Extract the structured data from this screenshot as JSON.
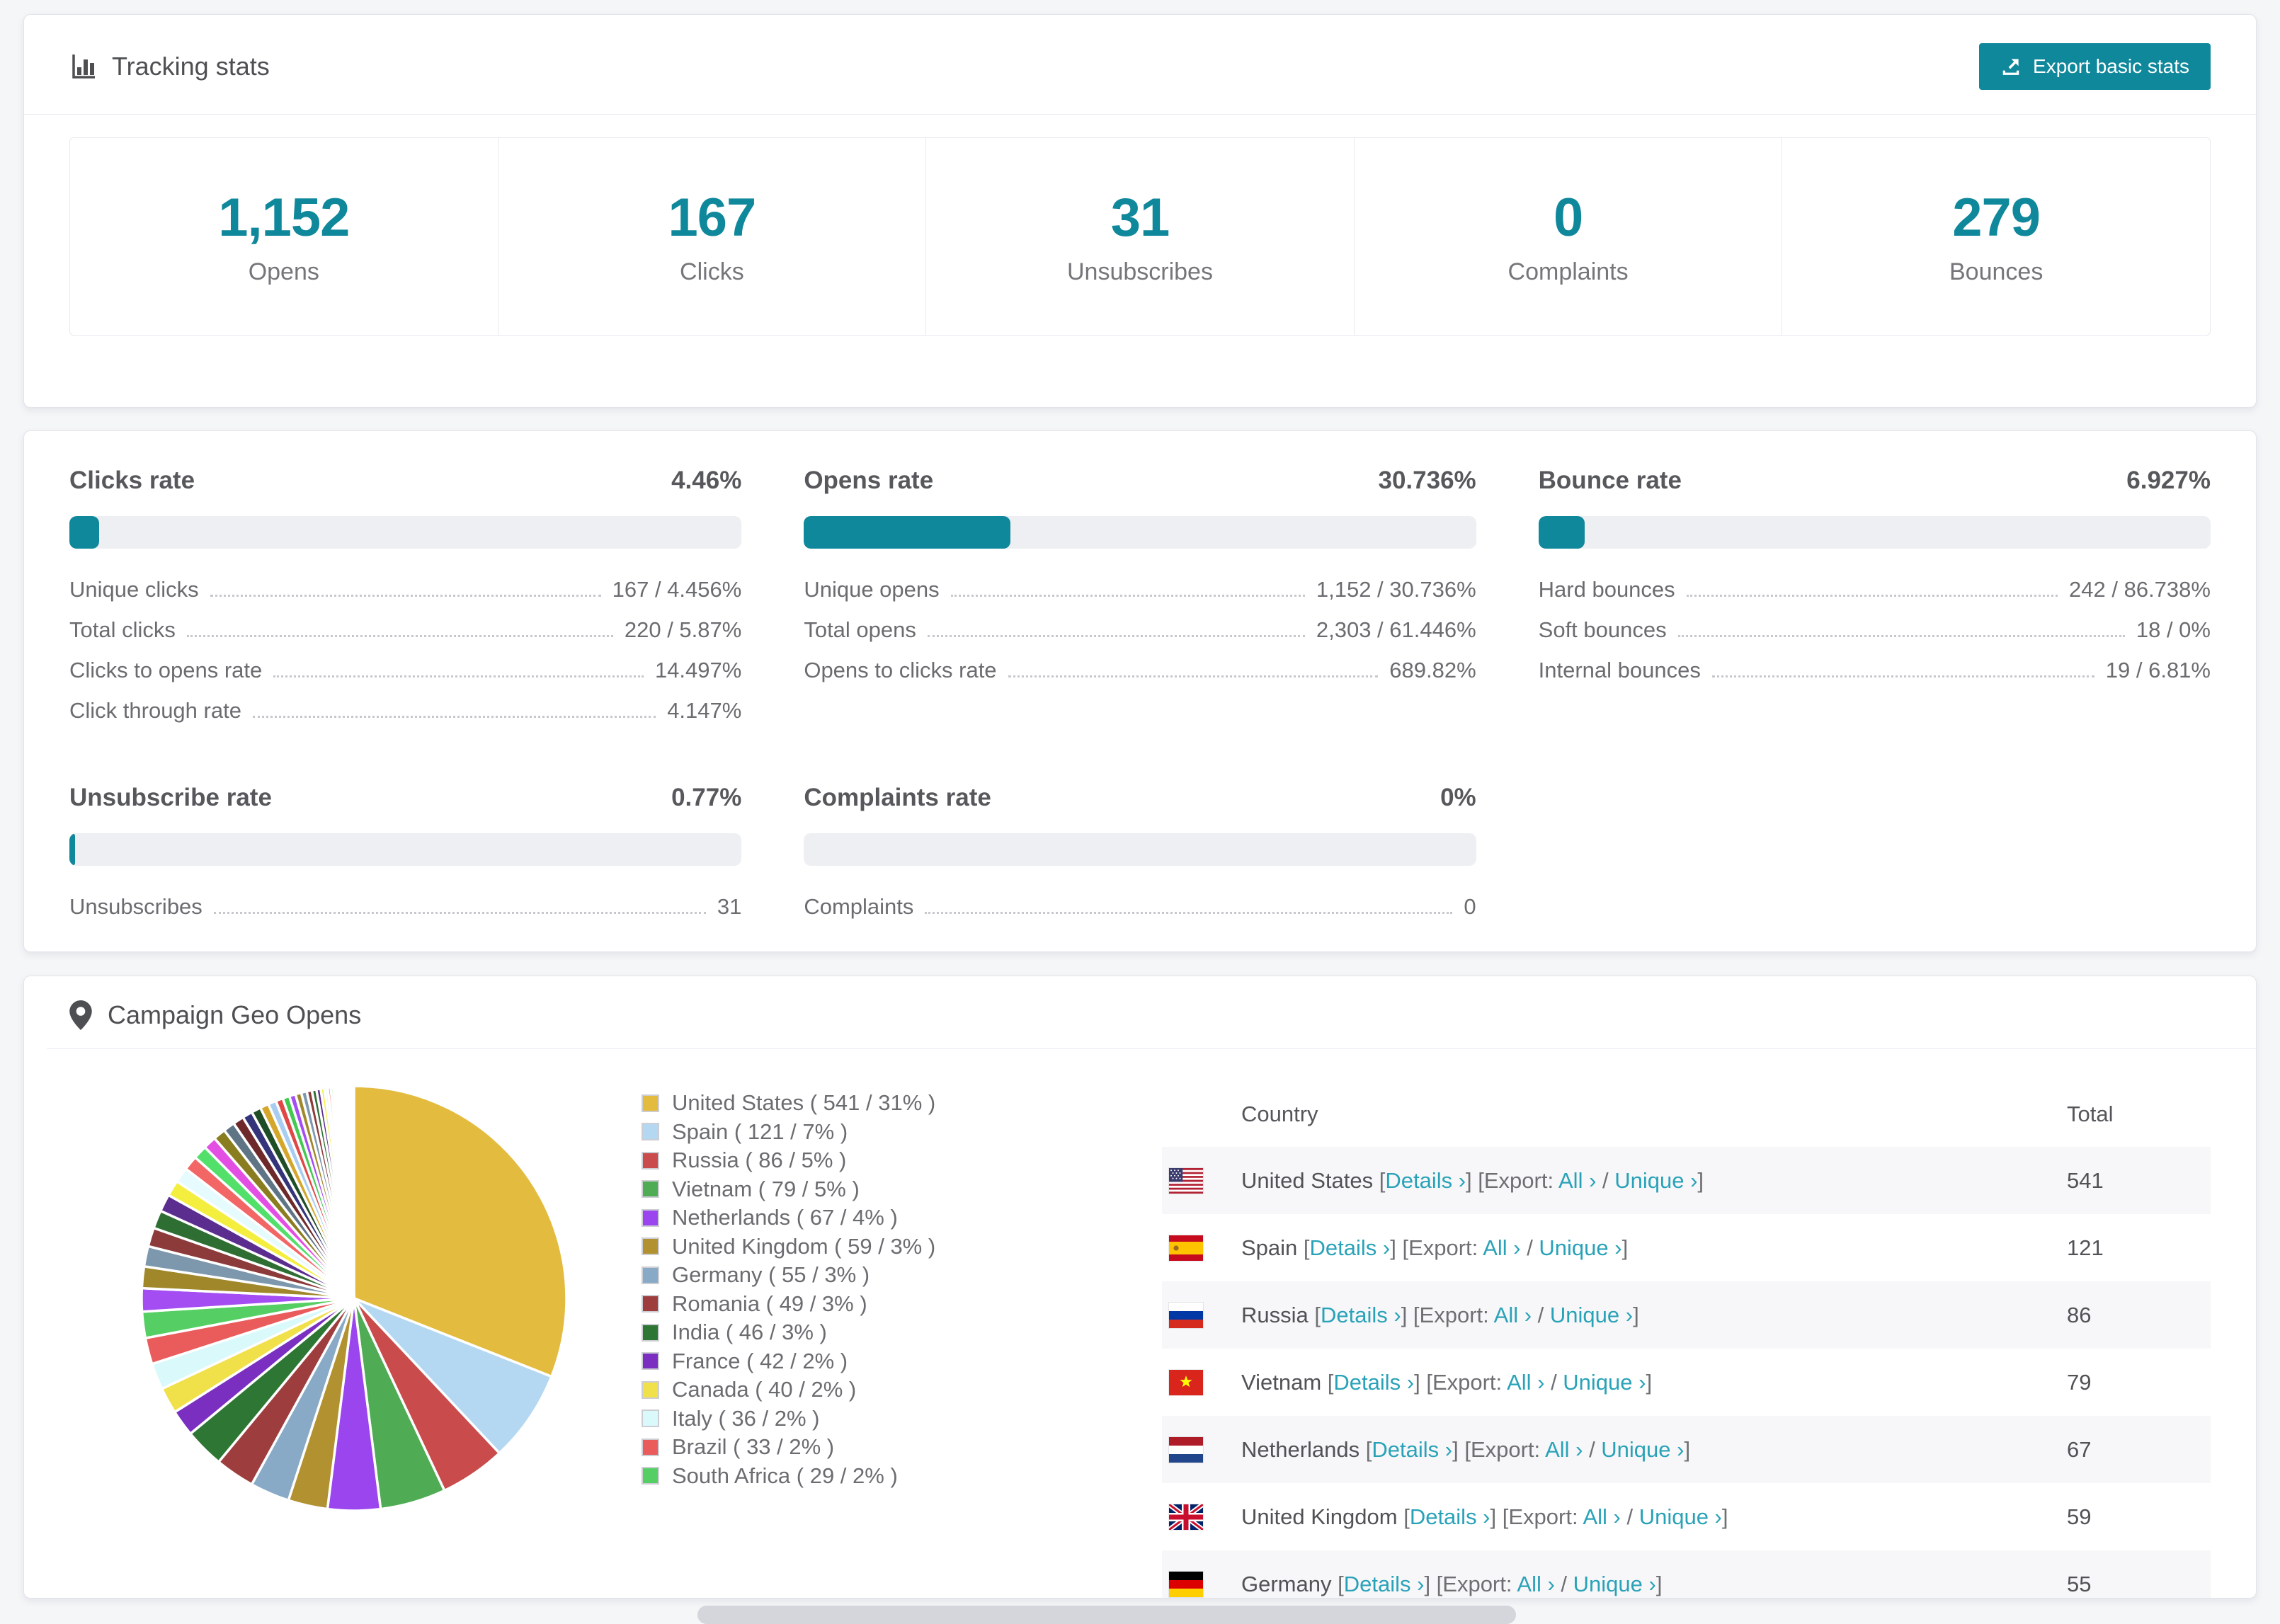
{
  "colors": {
    "accent": "#10889c",
    "link": "#29a2b8",
    "heading": "#57585c",
    "text": "#6b6c70"
  },
  "tracking": {
    "title": "Tracking stats",
    "export_button": "Export basic stats",
    "stats": [
      {
        "value": "1,152",
        "label": "Opens"
      },
      {
        "value": "167",
        "label": "Clicks"
      },
      {
        "value": "31",
        "label": "Unsubscribes"
      },
      {
        "value": "0",
        "label": "Complaints"
      },
      {
        "value": "279",
        "label": "Bounces"
      }
    ]
  },
  "rates": {
    "sections": [
      {
        "title": "Clicks rate",
        "value": "4.46%",
        "percent": 4.46,
        "rows": [
          {
            "label": "Unique clicks",
            "value": "167 / 4.456%"
          },
          {
            "label": "Total clicks",
            "value": "220 / 5.87%"
          },
          {
            "label": "Clicks to opens rate",
            "value": "14.497%"
          },
          {
            "label": "Click through rate",
            "value": "4.147%"
          }
        ]
      },
      {
        "title": "Opens rate",
        "value": "30.736%",
        "percent": 30.736,
        "rows": [
          {
            "label": "Unique opens",
            "value": "1,152 / 30.736%"
          },
          {
            "label": "Total opens",
            "value": "2,303 / 61.446%"
          },
          {
            "label": "Opens to clicks rate",
            "value": "689.82%"
          }
        ]
      },
      {
        "title": "Bounce rate",
        "value": "6.927%",
        "percent": 6.927,
        "rows": [
          {
            "label": "Hard bounces",
            "value": "242 / 86.738%"
          },
          {
            "label": "Soft bounces",
            "value": "18 / 0%"
          },
          {
            "label": "Internal bounces",
            "value": "19 / 6.81%"
          }
        ]
      },
      {
        "title": "Unsubscribe rate",
        "value": "0.77%",
        "percent": 0.77,
        "rows": [
          {
            "label": "Unsubscribes",
            "value": "31"
          }
        ]
      },
      {
        "title": "Complaints rate",
        "value": "0%",
        "percent": 0,
        "rows": [
          {
            "label": "Complaints",
            "value": "0"
          }
        ]
      }
    ]
  },
  "geo": {
    "title": "Campaign Geo Opens",
    "chart_data": {
      "type": "pie",
      "title": "Campaign Geo Opens",
      "legend_position": "right",
      "series": [
        {
          "name": "United States",
          "value": 541,
          "percent": 31,
          "color": "#e3bc3f"
        },
        {
          "name": "Spain",
          "value": 121,
          "percent": 7,
          "color": "#b5d8f2"
        },
        {
          "name": "Russia",
          "value": 86,
          "percent": 5,
          "color": "#c94b4b"
        },
        {
          "name": "Vietnam",
          "value": 79,
          "percent": 5,
          "color": "#4fab54"
        },
        {
          "name": "Netherlands",
          "value": 67,
          "percent": 4,
          "color": "#9a45ee"
        },
        {
          "name": "United Kingdom",
          "value": 59,
          "percent": 3,
          "color": "#b19130"
        },
        {
          "name": "Germany",
          "value": 55,
          "percent": 3,
          "color": "#88aac6"
        },
        {
          "name": "Romania",
          "value": 49,
          "percent": 3,
          "color": "#9e3d3d"
        },
        {
          "name": "India",
          "value": 46,
          "percent": 3,
          "color": "#2e7633"
        },
        {
          "name": "France",
          "value": 42,
          "percent": 2,
          "color": "#7a2fc1"
        },
        {
          "name": "Canada",
          "value": 40,
          "percent": 2,
          "color": "#f0e04a"
        },
        {
          "name": "Italy",
          "value": 36,
          "percent": 2,
          "color": "#d9f9fb"
        },
        {
          "name": "Brazil",
          "value": 33,
          "percent": 2,
          "color": "#ea5c5c"
        },
        {
          "name": "South Africa",
          "value": 29,
          "percent": 2,
          "color": "#55cf63"
        }
      ],
      "unlabeled_percents": [
        1.76,
        1.65,
        1.54,
        1.43,
        1.38,
        1.32,
        1.21,
        1.16,
        1.1,
        1.05,
        0.99,
        0.94,
        0.88,
        0.83,
        0.77,
        0.72,
        0.66,
        0.61,
        0.55,
        0.52,
        0.48,
        0.45,
        0.42,
        0.39,
        0.35,
        0.32,
        0.29,
        0.25,
        0.22,
        0.2,
        0.18,
        0.15,
        0.13,
        0.11,
        0.1,
        0.09,
        0.08,
        0.07,
        0.06,
        0.04
      ],
      "unlabeled_palette": [
        "#a34df2",
        "#a0882a",
        "#7d98ac",
        "#8c3a3a",
        "#2f6e33",
        "#5b2d8e",
        "#f4ef3f",
        "#e6fbfd",
        "#f26666",
        "#52e06a",
        "#e24fe2",
        "#8a7d1f",
        "#5f7485",
        "#6e2a2a",
        "#34347a",
        "#1f4d26",
        "#d4a72c",
        "#a8cdf0",
        "#e04848",
        "#42c94f"
      ]
    },
    "table": {
      "headers": [
        "Country",
        "Total"
      ],
      "link_labels": {
        "details": "Details ›",
        "export_prefix": "Export:",
        "all": "All ›",
        "unique": "Unique ›",
        "slash": "/"
      },
      "rows": [
        {
          "country": "United States",
          "flag": "us",
          "total": "541"
        },
        {
          "country": "Spain",
          "flag": "es",
          "total": "121"
        },
        {
          "country": "Russia",
          "flag": "ru",
          "total": "86"
        },
        {
          "country": "Vietnam",
          "flag": "vn",
          "total": "79"
        },
        {
          "country": "Netherlands",
          "flag": "nl",
          "total": "67"
        },
        {
          "country": "United Kingdom",
          "flag": "gb",
          "total": "59"
        },
        {
          "country": "Germany",
          "flag": "de",
          "total": "55"
        }
      ]
    }
  }
}
